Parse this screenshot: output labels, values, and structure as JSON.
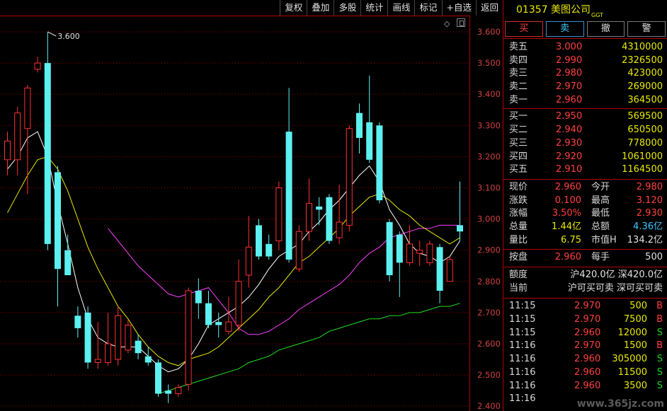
{
  "toolbar": [
    "复权",
    "叠加",
    "多股",
    "统计",
    "画线",
    "标记",
    "+自选",
    "返回"
  ],
  "chart": {
    "peak_label": "3.600",
    "axis_ticks": [
      "3.600",
      "3.500",
      "3.400",
      "3.300",
      "3.200",
      "3.100",
      "3.000",
      "2.900",
      "2.800",
      "2.700",
      "2.600",
      "2.500",
      "2.400"
    ],
    "colors": {
      "up": "#ff3030",
      "down": "#5cf0f0",
      "ma5": "#ffffff",
      "ma10": "#e8e800",
      "ma20": "#ff40ff",
      "ma60": "#20e020",
      "grid": "#a00000"
    }
  },
  "chart_data": {
    "type": "candlestick",
    "ylim": [
      2.4,
      3.64
    ],
    "y_ticks": [
      3.6,
      3.5,
      3.4,
      3.3,
      3.2,
      3.1,
      3.0,
      2.9,
      2.8,
      2.7,
      2.6,
      2.5,
      2.4
    ],
    "candles": [
      {
        "o": 3.19,
        "c": 3.25,
        "h": 3.28,
        "l": 3.14
      },
      {
        "o": 3.19,
        "c": 3.34,
        "h": 3.36,
        "l": 3.14
      },
      {
        "o": 3.29,
        "c": 3.42,
        "h": 3.43,
        "l": 3.08
      },
      {
        "o": 3.48,
        "c": 3.5,
        "h": 3.52,
        "l": 3.47
      },
      {
        "o": 3.5,
        "c": 2.92,
        "h": 3.6,
        "l": 2.9
      },
      {
        "o": 3.15,
        "c": 2.84,
        "h": 3.17,
        "l": 2.72
      },
      {
        "o": 2.9,
        "c": 2.82,
        "h": 2.95,
        "l": 2.82
      },
      {
        "o": 2.69,
        "c": 2.65,
        "h": 2.72,
        "l": 2.62
      },
      {
        "o": 2.7,
        "c": 2.54,
        "h": 2.72,
        "l": 2.52
      },
      {
        "o": 2.54,
        "c": 2.55,
        "h": 2.67,
        "l": 2.52
      },
      {
        "o": 2.54,
        "c": 2.6,
        "h": 2.7,
        "l": 2.53
      },
      {
        "o": 2.55,
        "c": 2.69,
        "h": 2.72,
        "l": 2.53
      },
      {
        "o": 2.58,
        "c": 2.66,
        "h": 2.68,
        "l": 2.57
      },
      {
        "o": 2.61,
        "c": 2.57,
        "h": 2.63,
        "l": 2.55
      },
      {
        "o": 2.56,
        "c": 2.54,
        "h": 2.59,
        "l": 2.53
      },
      {
        "o": 2.54,
        "c": 2.44,
        "h": 2.55,
        "l": 2.43
      },
      {
        "o": 2.45,
        "c": 2.44,
        "h": 2.47,
        "l": 2.41
      },
      {
        "o": 2.44,
        "c": 2.46,
        "h": 2.47,
        "l": 2.43
      },
      {
        "o": 2.47,
        "c": 2.77,
        "h": 2.78,
        "l": 2.45
      },
      {
        "o": 2.77,
        "c": 2.73,
        "h": 2.81,
        "l": 2.68
      },
      {
        "o": 2.73,
        "c": 2.66,
        "h": 2.77,
        "l": 2.65
      },
      {
        "o": 2.67,
        "c": 2.66,
        "h": 2.7,
        "l": 2.62
      },
      {
        "o": 2.64,
        "c": 2.67,
        "h": 2.75,
        "l": 2.63
      },
      {
        "o": 2.66,
        "c": 2.8,
        "h": 2.87,
        "l": 2.64
      },
      {
        "o": 2.82,
        "c": 2.91,
        "h": 3.01,
        "l": 2.78
      },
      {
        "o": 2.98,
        "c": 2.88,
        "h": 3.0,
        "l": 2.87
      },
      {
        "o": 2.92,
        "c": 2.88,
        "h": 2.95,
        "l": 2.87
      },
      {
        "o": 2.93,
        "c": 3.1,
        "h": 3.12,
        "l": 2.9
      },
      {
        "o": 3.28,
        "c": 2.87,
        "h": 3.42,
        "l": 2.86
      },
      {
        "o": 2.84,
        "c": 2.96,
        "h": 2.98,
        "l": 2.83
      },
      {
        "o": 2.96,
        "c": 3.05,
        "h": 3.13,
        "l": 2.93
      },
      {
        "o": 3.04,
        "c": 3.03,
        "h": 3.07,
        "l": 2.98
      },
      {
        "o": 3.07,
        "c": 2.93,
        "h": 3.08,
        "l": 2.92
      },
      {
        "o": 2.94,
        "c": 2.99,
        "h": 3.11,
        "l": 2.92
      },
      {
        "o": 2.98,
        "c": 3.29,
        "h": 3.3,
        "l": 2.96
      },
      {
        "o": 3.34,
        "c": 3.26,
        "h": 3.37,
        "l": 3.21
      },
      {
        "o": 3.31,
        "c": 3.19,
        "h": 3.46,
        "l": 3.18
      },
      {
        "o": 3.3,
        "c": 3.06,
        "h": 3.31,
        "l": 3.05
      },
      {
        "o": 2.99,
        "c": 2.82,
        "h": 3.0,
        "l": 2.8
      },
      {
        "o": 2.95,
        "c": 2.86,
        "h": 2.96,
        "l": 2.75
      },
      {
        "o": 2.86,
        "c": 2.92,
        "h": 2.98,
        "l": 2.85
      },
      {
        "o": 2.89,
        "c": 2.9,
        "h": 2.93,
        "l": 2.85
      },
      {
        "o": 2.86,
        "c": 2.92,
        "h": 2.93,
        "l": 2.85
      },
      {
        "o": 2.91,
        "c": 2.77,
        "h": 2.92,
        "l": 2.73
      },
      {
        "o": 2.8,
        "c": 2.87,
        "h": 2.88,
        "l": 2.8
      },
      {
        "o": 2.98,
        "c": 2.96,
        "h": 3.12,
        "l": 2.93
      }
    ],
    "ma5": [
      3.16,
      3.2,
      3.26,
      3.28,
      3.2,
      3.05,
      2.92,
      2.78,
      2.68,
      2.62,
      2.6,
      2.59,
      2.59,
      2.59,
      2.56,
      2.53,
      2.51,
      2.52,
      2.55,
      2.6,
      2.66,
      2.68,
      2.7,
      2.72,
      2.75,
      2.79,
      2.84,
      2.88,
      2.9,
      2.92,
      2.96,
      2.99,
      3.03,
      3.06,
      3.1,
      3.14,
      3.17,
      3.12,
      3.03,
      2.98,
      2.92,
      2.89,
      2.88,
      2.86,
      2.88,
      2.93
    ],
    "ma10": [
      3.02,
      3.08,
      3.14,
      3.19,
      3.2,
      3.16,
      3.09,
      3.0,
      2.91,
      2.84,
      2.78,
      2.72,
      2.68,
      2.63,
      2.59,
      2.56,
      2.54,
      2.53,
      2.55,
      2.56,
      2.57,
      2.59,
      2.62,
      2.65,
      2.68,
      2.71,
      2.75,
      2.78,
      2.82,
      2.86,
      2.88,
      2.91,
      2.94,
      2.97,
      3.01,
      3.04,
      3.07,
      3.08,
      3.06,
      3.03,
      3.01,
      2.98,
      2.96,
      2.94,
      2.92,
      2.94
    ],
    "ma20": [
      null,
      null,
      null,
      null,
      null,
      null,
      null,
      null,
      null,
      null,
      2.97,
      2.93,
      2.89,
      2.85,
      2.82,
      2.79,
      2.76,
      2.75,
      2.76,
      2.77,
      2.78,
      2.74,
      2.7,
      2.65,
      2.63,
      2.63,
      2.64,
      2.66,
      2.68,
      2.71,
      2.73,
      2.75,
      2.77,
      2.79,
      2.82,
      2.86,
      2.89,
      2.91,
      2.94,
      2.95,
      2.96,
      2.97,
      2.97,
      2.98,
      2.98,
      2.98
    ],
    "ma60": [
      null,
      null,
      null,
      null,
      null,
      null,
      null,
      null,
      null,
      null,
      null,
      null,
      null,
      null,
      null,
      2.44,
      2.45,
      2.46,
      2.47,
      2.48,
      2.49,
      2.5,
      2.51,
      2.52,
      2.54,
      2.55,
      2.56,
      2.58,
      2.59,
      2.6,
      2.61,
      2.62,
      2.64,
      2.65,
      2.66,
      2.67,
      2.68,
      2.68,
      2.69,
      2.69,
      2.7,
      2.7,
      2.71,
      2.72,
      2.72,
      2.73
    ]
  },
  "stock": {
    "code": "01357",
    "name": "美图公司",
    "tag": "GGT"
  },
  "trade_buttons": [
    "买",
    "卖",
    "撤",
    "警"
  ],
  "asks": [
    {
      "label": "卖五",
      "price": "3.000",
      "volume": "4310000"
    },
    {
      "label": "卖四",
      "price": "2.990",
      "volume": "2326500"
    },
    {
      "label": "卖三",
      "price": "2.980",
      "volume": "423000"
    },
    {
      "label": "卖二",
      "price": "2.970",
      "volume": "269000"
    },
    {
      "label": "卖一",
      "price": "2.960",
      "volume": "364500"
    }
  ],
  "bids": [
    {
      "label": "买一",
      "price": "2.950",
      "volume": "569500"
    },
    {
      "label": "买二",
      "price": "2.940",
      "volume": "650500"
    },
    {
      "label": "买三",
      "price": "2.930",
      "volume": "778000"
    },
    {
      "label": "买四",
      "price": "2.920",
      "volume": "1061000"
    },
    {
      "label": "买五",
      "price": "2.910",
      "volume": "1164500"
    }
  ],
  "quote": [
    {
      "l1": "现价",
      "v1": "2.960",
      "l2": "今开",
      "v2": "2.980"
    },
    {
      "l1": "涨跌",
      "v1": "0.100",
      "l2": "最高",
      "v2": "3.120"
    },
    {
      "l1": "涨幅",
      "v1": "3.50%",
      "l2": "最低",
      "v2": "2.930"
    },
    {
      "l1": "总量",
      "v1": "1.44亿",
      "l2": "总额",
      "v2": "4.36亿"
    },
    {
      "l1": "量比",
      "v1": "6.75",
      "l2": "市值H",
      "v2": "134.2亿"
    }
  ],
  "lot": {
    "l1": "按盘",
    "v1": "2.960",
    "l2": "每手",
    "v2": "500"
  },
  "quota": {
    "label1": "额度",
    "value1": "沪420.0亿 深420.0亿",
    "label2": "当前",
    "value2": "沪可买可卖 深可买可卖"
  },
  "ticks": [
    {
      "time": "11:15",
      "price": "2.970",
      "volume": "500",
      "side": "B"
    },
    {
      "time": "11:15",
      "price": "2.970",
      "volume": "7500",
      "side": "B"
    },
    {
      "time": "11:15",
      "price": "2.960",
      "volume": "12000",
      "side": "S"
    },
    {
      "time": "11:16",
      "price": "2.970",
      "volume": "1500",
      "side": "B"
    },
    {
      "time": "11:16",
      "price": "2.960",
      "volume": "305000",
      "side": "S"
    },
    {
      "time": "11:16",
      "price": "2.960",
      "volume": "11500",
      "side": "S"
    },
    {
      "time": "11:16",
      "price": "2.960",
      "volume": "3500",
      "side": "S"
    },
    {
      "time": "11:16",
      "price": "",
      "volume": "",
      "side": ""
    }
  ],
  "watermark": "www.365jz.com"
}
